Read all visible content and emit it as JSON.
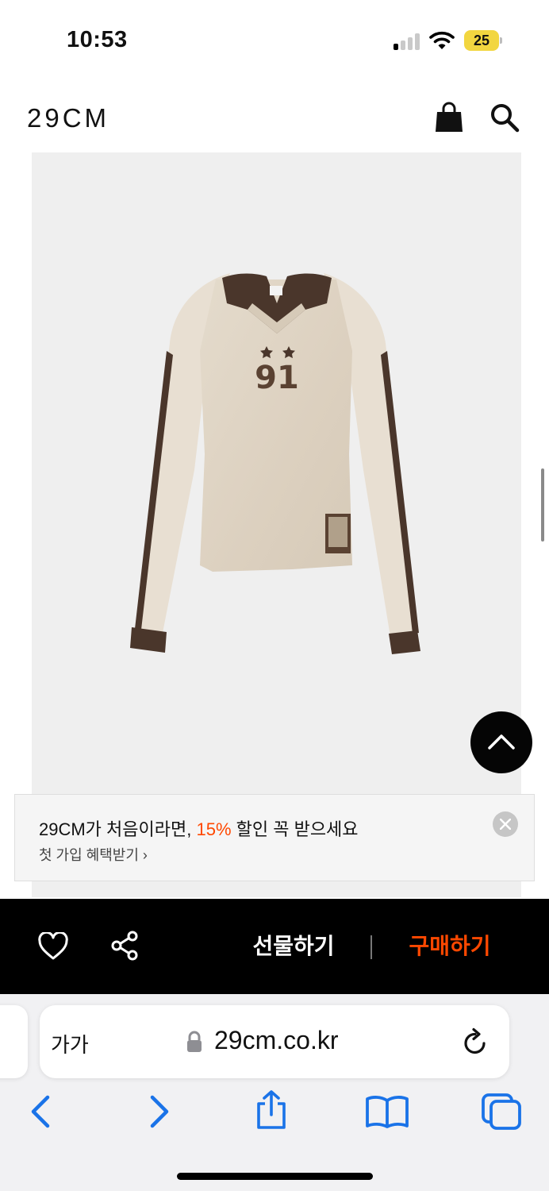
{
  "status_bar": {
    "time": "10:53",
    "battery_level": "25",
    "icons": [
      "cellular-signal-icon",
      "wifi-icon",
      "battery-icon"
    ]
  },
  "header": {
    "logo": "29CM",
    "icons": [
      "shopping-bag-icon",
      "search-icon"
    ]
  },
  "product": {
    "image": "long-sleeve-top-photo",
    "print_number": "91",
    "colors": {
      "body": "#ddd3c3",
      "trim": "#4a362b",
      "background": "#efefef"
    }
  },
  "promo_banner": {
    "title_prefix": "29CM가 처음이라면, ",
    "title_highlight": "15%",
    "title_suffix": " 할인 꼭 받으세요",
    "link_text": "첫 가입 혜택받기 ›",
    "highlight_color": "#ff4800"
  },
  "action_bar": {
    "gift_label": "선물하기",
    "buy_label": "구매하기",
    "icons": [
      "heart-icon",
      "share-icon"
    ],
    "buy_color": "#ff4800"
  },
  "browser": {
    "text_size_label": "가가",
    "url": "29cm.co.kr",
    "icons": [
      "lock-icon",
      "reload-icon",
      "back-icon",
      "forward-icon",
      "share-icon",
      "bookmarks-icon",
      "tabs-icon"
    ],
    "accent_color": "#1a73e8"
  }
}
